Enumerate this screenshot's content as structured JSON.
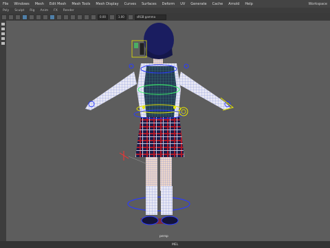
{
  "menubar": {
    "items": [
      "File",
      "Windows",
      "Mesh",
      "Edit Mesh",
      "Mesh Tools",
      "Mesh Display",
      "Curves",
      "Surfaces",
      "Deform",
      "UV",
      "Generate",
      "Cache",
      "Arnold",
      "Help"
    ],
    "right_label": "Workspace"
  },
  "tabs": {
    "items": [
      "Poly",
      "Sculpt",
      "Rig",
      "Anim",
      "FX",
      "Render"
    ]
  },
  "toolbar": {
    "field1": "0.00",
    "field2": "1.00",
    "field3": "sRGB gamma"
  },
  "viewport": {
    "camera_label": "persp"
  },
  "status": {
    "mel_label": "MEL"
  },
  "colors": {
    "viewport_bg": "#5d5d5d",
    "wireframe": "#7a8ad8",
    "control_blue": "#2a3bff",
    "control_yellow": "#e8e800",
    "control_green": "#3cff6a"
  }
}
